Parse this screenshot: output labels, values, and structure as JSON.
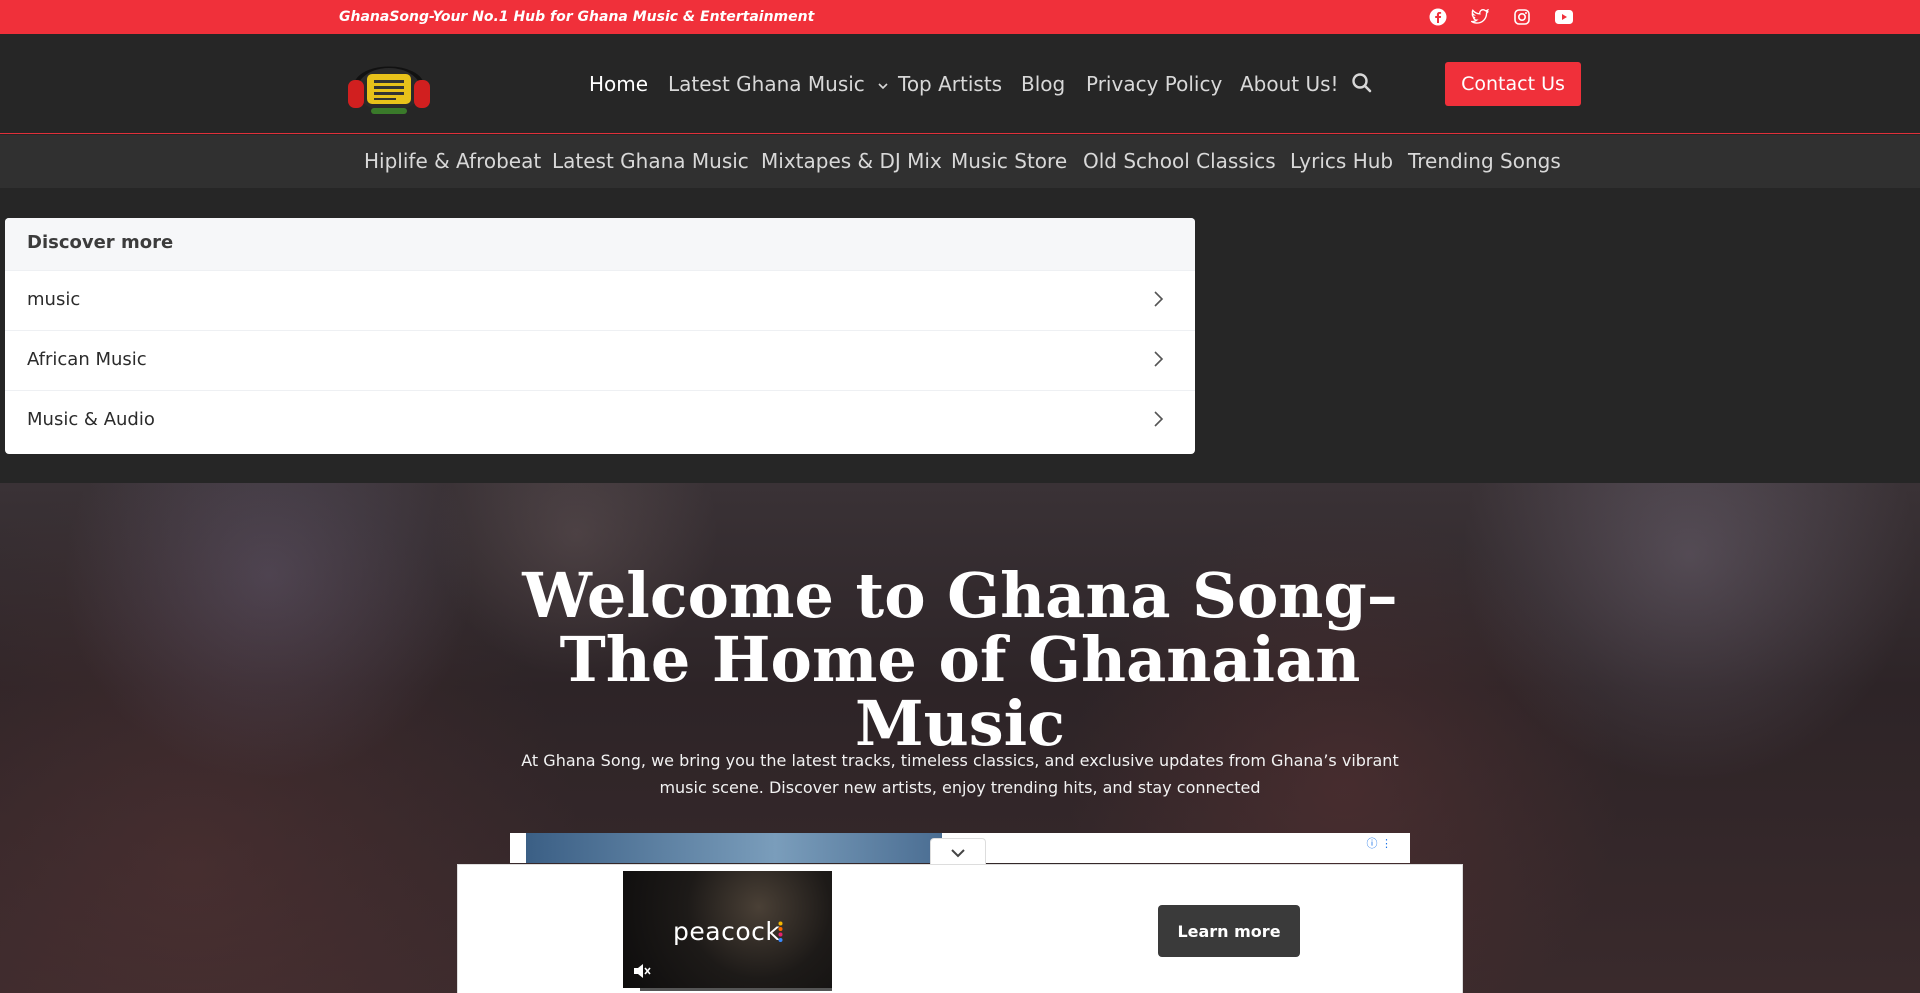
{
  "topbar": {
    "tagline": "GhanaSong-Your No.1 Hub for Ghana Music & Entertainment",
    "social_icons": [
      "facebook-icon",
      "twitter-icon",
      "instagram-icon",
      "youtube-icon"
    ],
    "background_color": "#f0303a"
  },
  "header": {
    "nav": [
      {
        "label": "Home",
        "active": true
      },
      {
        "label": "Latest Ghana Music",
        "has_dropdown": true
      },
      {
        "label": "Top Artists"
      },
      {
        "label": "Blog"
      },
      {
        "label": "Privacy Policy"
      },
      {
        "label": "About Us!"
      }
    ],
    "search_icon": "search-icon",
    "contact_label": "Contact Us",
    "accent_color": "#f0303a"
  },
  "subnav": {
    "items": [
      "Hiplife & Afrobeat",
      "Latest Ghana Music",
      "Mixtapes & DJ Mix",
      "Music Store",
      "Old School Classics",
      "Lyrics Hub",
      "Trending Songs"
    ]
  },
  "discover": {
    "heading": "Discover more",
    "items": [
      "music",
      "African Music",
      "Music & Audio"
    ]
  },
  "hero": {
    "title": "Welcome to Ghana Song– The Home of Ghanaian Music",
    "text": "At Ghana Song, we bring you the latest tracks, timeless classics, and exclusive updates from Ghana’s vibrant music scene. Discover new artists, enjoy trending hits, and stay connected"
  },
  "ad": {
    "brand": "peacock",
    "cta_label": "Learn more",
    "progress": 0.08
  }
}
